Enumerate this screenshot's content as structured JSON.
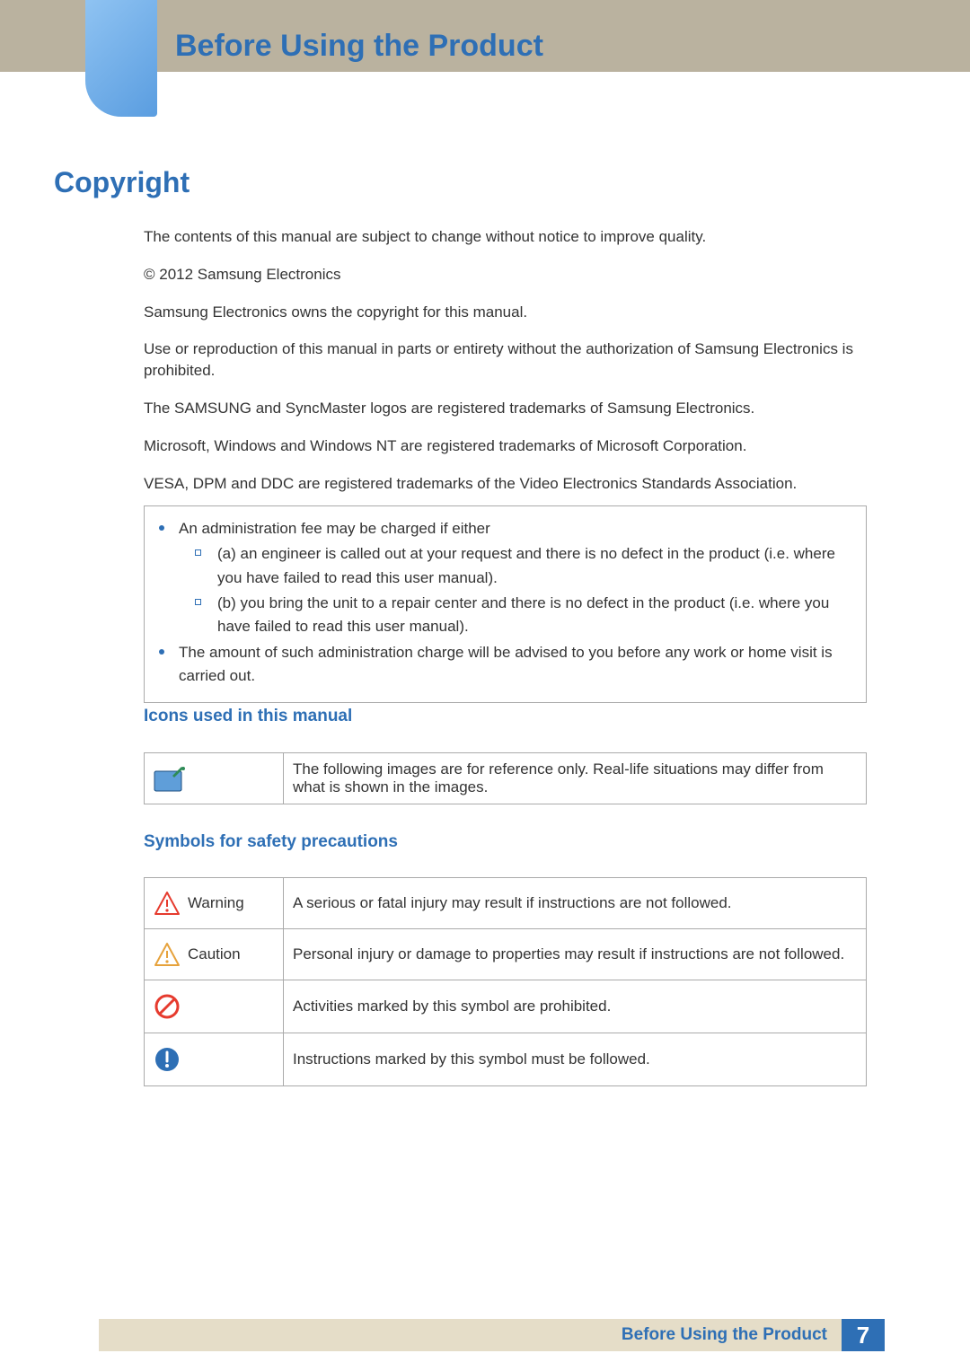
{
  "header": {
    "chapter_title": "Before Using the Product"
  },
  "section": {
    "title": "Copyright",
    "paragraphs": [
      "The contents of this manual are subject to change without notice to improve quality.",
      "© 2012 Samsung Electronics",
      "Samsung Electronics owns the copyright for this manual.",
      "Use or reproduction of this manual in parts or entirety without the authorization of Samsung Electronics is prohibited.",
      "The SAMSUNG and SyncMaster logos are registered trademarks of Samsung Electronics.",
      "Microsoft, Windows and Windows NT are registered trademarks of Microsoft Corporation.",
      "VESA, DPM and DDC are registered trademarks of the Video Electronics Standards Association."
    ]
  },
  "fee_box": {
    "bullets": [
      {
        "text": "An administration fee may be charged if either",
        "subs": [
          "(a) an engineer is called out at your request and there is no defect in the product (i.e. where you have failed to read this user manual).",
          "(b) you bring the unit to a repair center and there is no defect in the product (i.e. where you have failed to read this user manual)."
        ]
      },
      {
        "text": "The amount of such administration charge will be advised to you before any work or home visit is carried out.",
        "subs": []
      }
    ]
  },
  "icons_section": {
    "heading": "Icons used in this manual",
    "rows": [
      {
        "icon": "note-icon",
        "label": "",
        "desc": "The following images are for reference only. Real-life situations may differ from what is shown in the images."
      }
    ]
  },
  "symbols_section": {
    "heading": "Symbols for safety precautions",
    "rows": [
      {
        "icon": "warning-icon",
        "label": "Warning",
        "desc": "A serious or fatal injury may result if instructions are not followed."
      },
      {
        "icon": "caution-icon",
        "label": "Caution",
        "desc": "Personal injury or damage to properties may result if instructions are not followed."
      },
      {
        "icon": "prohibit-icon",
        "label": "",
        "desc": "Activities marked by this symbol are prohibited."
      },
      {
        "icon": "must-follow-icon",
        "label": "",
        "desc": "Instructions marked by this symbol must be followed."
      }
    ]
  },
  "footer": {
    "title": "Before Using the Product",
    "page": "7"
  }
}
